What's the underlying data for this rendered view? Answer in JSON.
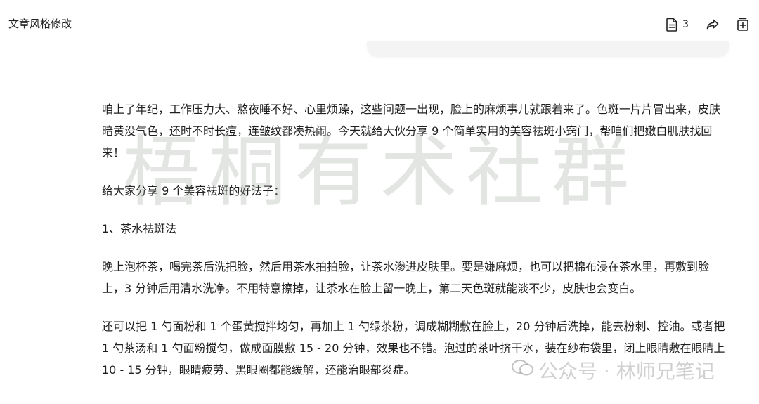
{
  "header": {
    "title": "文章风格修改",
    "doc_count": "3"
  },
  "icons": {
    "document": "document-icon",
    "share": "share-arrow-icon",
    "add": "add-note-icon"
  },
  "watermarks": {
    "large": "梧桐有术社群",
    "small": "公众号 · 林师兄笔记"
  },
  "article": {
    "paragraphs": [
      "咱上了年纪，工作压力大、熬夜睡不好、心里烦躁，这些问题一出现，脸上的麻烦事儿就跟着来了。色斑一片片冒出来，皮肤暗黄没气色，还时不时长痘，连皱纹都凑热闹。今天就给大伙分享 9 个简单实用的美容祛斑小窍门，帮咱们把嫩白肌肤找回来！",
      "给大家分享 9 个美容祛斑的好法子：",
      "1、茶水祛斑法",
      "晚上泡杯茶，喝完茶后洗把脸，然后用茶水拍拍脸，让茶水渗进皮肤里。要是嫌麻烦，也可以把棉布浸在茶水里，再敷到脸上，3 分钟后用清水洗净。不用特意擦掉，让茶水在脸上留一晚上，第二天色斑就能淡不少，皮肤也会变白。",
      "还可以把 1 勺面粉和 1 个蛋黄搅拌均匀，再加上 1 勺绿茶粉，调成糊糊敷在脸上，20 分钟后洗掉，能去粉刺、控油。或者把 1 勺茶汤和 1 勺面粉搅匀，做成面膜敷 15 - 20 分钟，效果也不错。泡过的茶叶挤干水，装在纱布袋里，闭上眼睛敷在眼睛上 10 - 15 分钟，眼睛疲劳、黑眼圈都能缓解，还能治眼部炎症。"
    ]
  }
}
